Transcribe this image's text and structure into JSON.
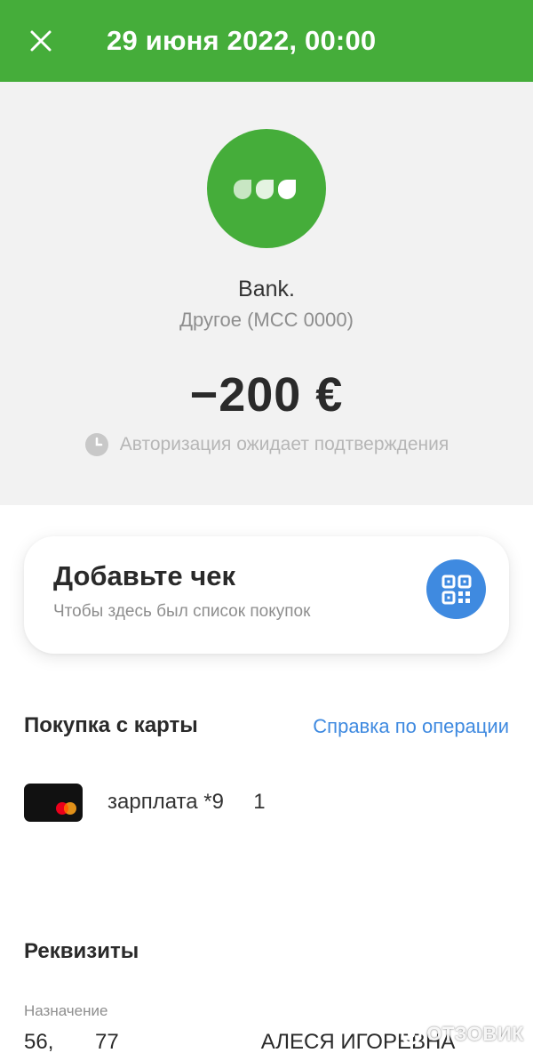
{
  "topbar": {
    "title": "29 июня 2022, 00:00",
    "background": "#45ad3a",
    "close_icon": "close-icon"
  },
  "merchant": {
    "name": "Bank.",
    "category": "Другое (MCC 0000)",
    "logo_color": "#45ad3a",
    "logo_icon": "three-dots-logo-icon"
  },
  "transaction": {
    "amount": "−200 €",
    "status": "Авторизация ожидает подтверждения",
    "status_icon": "clock-icon"
  },
  "receipt": {
    "title": "Добавьте чек",
    "subtitle": "Чтобы здесь был список покупок",
    "qr_icon": "qr-code-icon",
    "accent": "#3f8ae0"
  },
  "card_section": {
    "title": "Покупка с карты",
    "help_link": "Справка по операции",
    "card_label": "зарплата *9     1",
    "card_icon": "mastercard-icon"
  },
  "details": {
    "title": "Реквизиты",
    "purpose_label": "Назначение",
    "purpose_value": "56,       77                        АЛЕСЯ ИГОРЕВНА"
  },
  "watermark": {
    "text": "ОТЗОВИК"
  }
}
